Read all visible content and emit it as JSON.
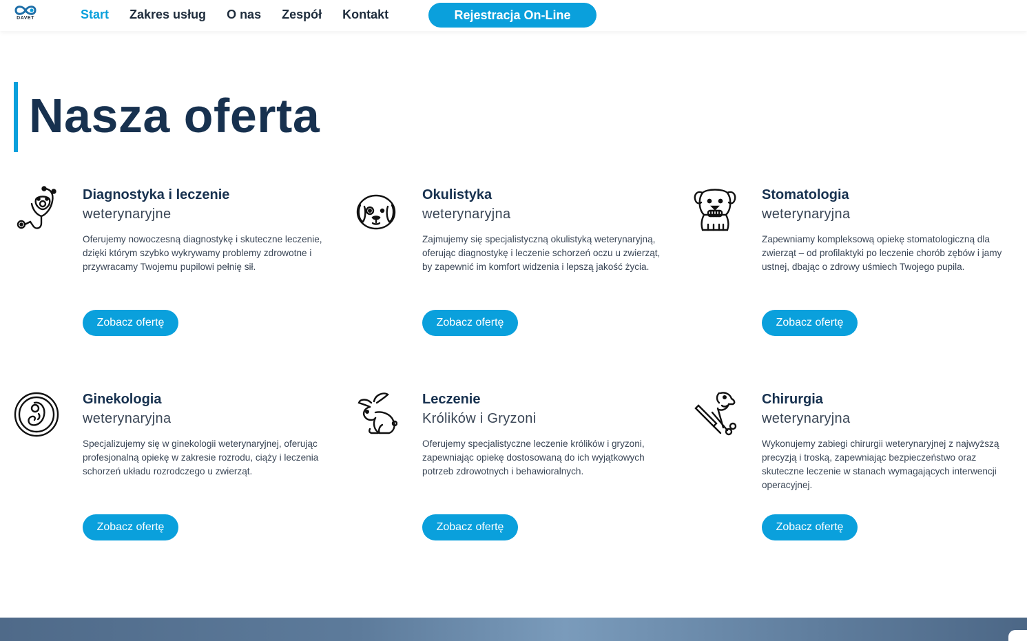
{
  "header": {
    "logo_text": "DAVET",
    "nav": [
      {
        "label": "Start"
      },
      {
        "label": "Zakres usług"
      },
      {
        "label": "O nas"
      },
      {
        "label": "Zespół"
      },
      {
        "label": "Kontakt"
      }
    ],
    "cta_label": "Rejestracja On-Line"
  },
  "main": {
    "title": "Nasza oferta",
    "cards": [
      {
        "icon": "stethoscope-paw-icon",
        "title": "Diagnostyka i leczenie",
        "subtitle": "weterynaryjne",
        "description": "Oferujemy nowoczesną diagnostykę i skuteczne leczenie, dzięki którym szybko wykrywamy problemy zdrowotne i przywracamy Twojemu pupilowi pełnię sił.",
        "button": "Zobacz ofertę"
      },
      {
        "icon": "dog-eye-icon",
        "title": "Okulistyka",
        "subtitle": "weterynaryjna",
        "description": "Zajmujemy się specjalistyczną okulistyką weterynaryjną, oferując diagnostykę i leczenie schorzeń oczu u zwierząt, by zapewnić im komfort widzenia i lepszą jakość życia.",
        "button": "Zobacz ofertę"
      },
      {
        "icon": "dog-teeth-icon",
        "title": "Stomatologia",
        "subtitle": "weterynaryjna",
        "description": "Zapewniamy kompleksową opiekę stomatologiczną dla zwierząt – od profilaktyki po leczenie chorób zębów i jamy ustnej, dbając o zdrowy uśmiech Twojego pupila.",
        "button": "Zobacz ofertę"
      },
      {
        "icon": "ultrasound-embryo-icon",
        "title": "Ginekologia",
        "subtitle": "weterynaryjna",
        "description": "Specjalizujemy się w ginekologii weterynaryjnej, oferując profesjonalną opiekę w zakresie rozrodu, ciąży i leczenia schorzeń układu rozrodczego u zwierząt.",
        "button": "Zobacz ofertę"
      },
      {
        "icon": "rabbit-icon",
        "title": "Leczenie",
        "subtitle": "Królików i Gryzoni",
        "description": "Oferujemy specjalistyczne leczenie królików i gryzoni, zapewniając opiekę dostosowaną do ich wyjątkowych potrzeb zdrowotnych i behawioralnych.",
        "button": "Zobacz ofertę"
      },
      {
        "icon": "surgery-tools-icon",
        "title": "Chirurgia",
        "subtitle": "weterynaryjna",
        "description": "Wykonujemy zabiegi chirurgii weterynaryjnej z najwyższą precyzją i troską, zapewniając bezpieczeństwo oraz skuteczne leczenie w stanach wymagających interwencji operacyjnej.",
        "button": "Zobacz ofertę"
      }
    ]
  },
  "colors": {
    "accent": "#0aa0dc",
    "heading": "#17314f",
    "text": "#3a4656"
  }
}
